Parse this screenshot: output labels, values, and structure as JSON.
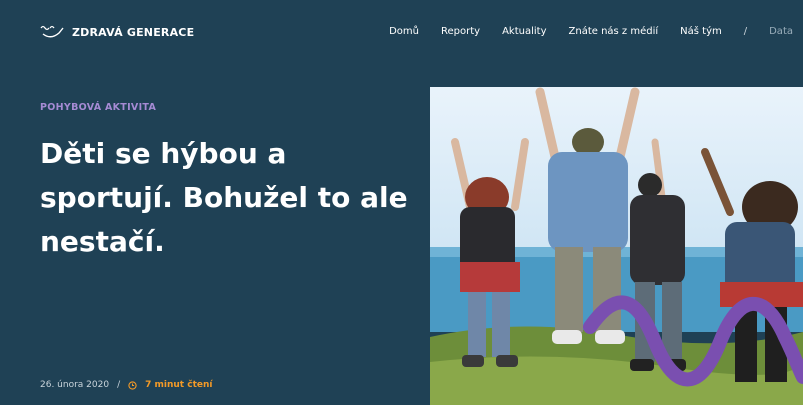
{
  "brand": {
    "name": "ZDRAVÁ GENERACE",
    "logo_icon": "wave-smile-icon"
  },
  "nav": {
    "items": [
      "Domů",
      "Reporty",
      "Aktuality",
      "Znáte nás z médií",
      "Náš tým"
    ],
    "separator": "/",
    "data_label": "Data"
  },
  "article": {
    "category": "POHYBOVÁ AKTIVITA",
    "title": "Děti se hýbou a sportují. Bohužel to ale nestačí.",
    "date": "26. února 2020",
    "separator": "/",
    "reading_time": "7 minut čtení",
    "reading_icon": "clock-icon"
  },
  "colors": {
    "background": "#1f4155",
    "kicker": "#a68bd4",
    "accent_orange": "#f39a27",
    "wave_purple": "#7a4fb0"
  }
}
